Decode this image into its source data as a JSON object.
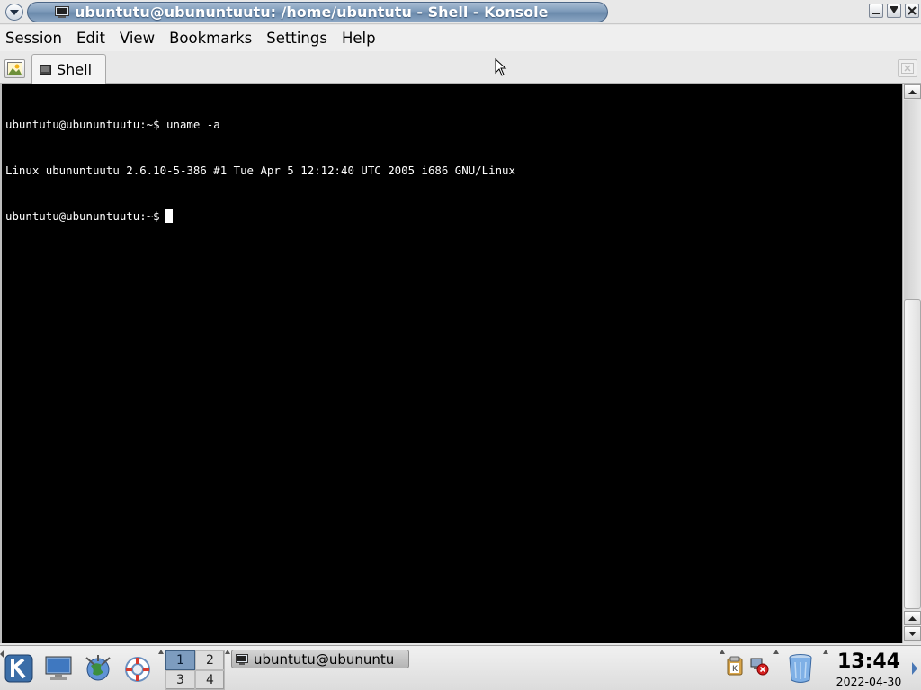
{
  "window": {
    "title": "ubuntutu@ubununtuutu: /home/ubuntutu - Shell - Konsole"
  },
  "menubar": {
    "items": [
      "Session",
      "Edit",
      "View",
      "Bookmarks",
      "Settings",
      "Help"
    ]
  },
  "tabs": [
    {
      "label": "Shell",
      "active": true
    }
  ],
  "terminal": {
    "lines": [
      "ubuntutu@ubununtuutu:~$ uname -a",
      "Linux ubununtuutu 2.6.10-5-386 #1 Tue Apr 5 12:12:40 UTC 2005 i686 GNU/Linux",
      "ubuntutu@ubununtuutu:~$"
    ],
    "background": "#000000",
    "foreground": "#ffffff"
  },
  "taskbar": {
    "pager": [
      "1",
      "2",
      "3",
      "4"
    ],
    "active_desktop": "1",
    "task_label": "ubuntutu@ubununtu",
    "clock_time": "13:44",
    "clock_date": "2022-04-30"
  },
  "icons": {
    "window_menu": "chevron-down-icon",
    "title_terminal": "terminal-icon",
    "minimize": "minimize-icon",
    "maximize": "maximize-icon",
    "close": "close-icon",
    "new_tab": "new-session-icon",
    "close_tab": "close-session-icon",
    "kmenu": "kde-k-icon",
    "show_desktop": "desktop-icon",
    "web_browser": "konqueror-globe-icon",
    "help": "help-lifebuoy-icon",
    "klipper": "klipper-clipboard-icon",
    "network_error": "network-disconnected-icon",
    "trash": "trash-can-icon"
  },
  "colors": {
    "titlebar_accent": "#7e9bba",
    "pager_active": "#7d9cbf"
  }
}
